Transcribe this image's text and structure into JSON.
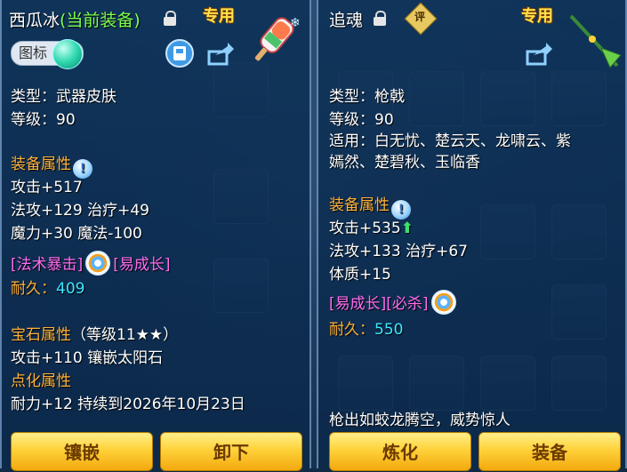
{
  "left": {
    "title": "西瓜冰",
    "title_state": "(当前装备)",
    "exclusive": "专用",
    "badge": "图标",
    "type": "类型：武器皮肤",
    "level": "等级：90",
    "attr_header": "装备属性",
    "attr_1": "攻击+517",
    "attr_2": "法攻+129 治疗+49",
    "attr_3": "魔力+30 魔法-100",
    "tag_1": "[法术暴击]",
    "tag_2": "[易成长]",
    "durability_label": "耐久：",
    "durability_value": "409",
    "gem_header": "宝石属性",
    "gem_level": "（等级11★★）",
    "gem_attr": "攻击+110 镶嵌太阳石",
    "point_header": "点化属性",
    "point_attr": "耐力+12 持续到2026年10月23日",
    "btn_inlay": "镶嵌",
    "btn_unequip": "卸下"
  },
  "right": {
    "title": "追魂",
    "review_badge": "评",
    "exclusive": "专用",
    "type": "类型：枪戟",
    "level": "等级：90",
    "suitable_1": "适用：白无忧、楚云天、龙啸云、紫",
    "suitable_2": "嫣然、楚碧秋、玉临香",
    "attr_header": "装备属性",
    "attr_1": "攻击+535",
    "attr_2": "法攻+133 治疗+67",
    "attr_3": "体质+15",
    "tags": "[易成长][必杀]",
    "durability_label": "耐久：",
    "durability_value": "550",
    "description": "枪出如蛟龙腾空，威势惊人",
    "btn_refine": "炼化",
    "btn_equip": "装备"
  },
  "colors": {
    "title_state": "#7dff4b",
    "header": "#ffb23a",
    "tag": "#ff6cf0",
    "durability": "#3ee6ff",
    "button": "#ffd23a"
  }
}
